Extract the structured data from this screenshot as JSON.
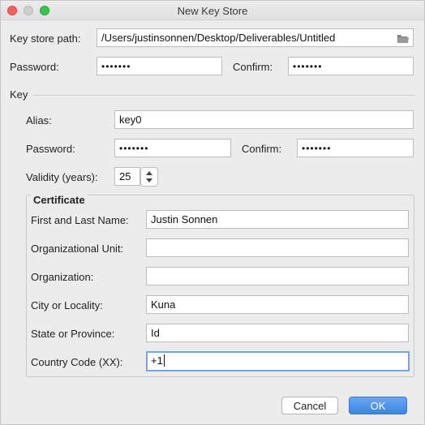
{
  "window": {
    "title": "New Key Store"
  },
  "keystore": {
    "path_label": "Key store path:",
    "path_value": "/Users/justinsonnen/Desktop/Deliverables/Untitled",
    "password_label": "Password:",
    "password_value": "•••••••",
    "confirm_label": "Confirm:",
    "confirm_value": "•••••••"
  },
  "key": {
    "section_label": "Key",
    "alias_label": "Alias:",
    "alias_value": "key0",
    "password_label": "Password:",
    "password_value": "•••••••",
    "confirm_label": "Confirm:",
    "confirm_value": "•••••••",
    "validity_label": "Validity (years):",
    "validity_value": "25"
  },
  "certificate": {
    "section_label": "Certificate",
    "fields": [
      {
        "label": "First and Last Name:",
        "value": "Justin Sonnen"
      },
      {
        "label": "Organizational Unit:",
        "value": ""
      },
      {
        "label": "Organization:",
        "value": ""
      },
      {
        "label": "City or Locality:",
        "value": "Kuna"
      },
      {
        "label": "State or Province:",
        "value": "Id"
      },
      {
        "label": "Country Code (XX):",
        "value": "+1"
      }
    ]
  },
  "buttons": {
    "cancel": "Cancel",
    "ok": "OK"
  },
  "colors": {
    "ok_button": "#3d84e6",
    "focus_ring": "#78a6dc",
    "close": "#fc605c",
    "maximize": "#34c84a"
  },
  "icons": {
    "browse": "folder-icon",
    "stepper": "stepper-arrows-icon"
  }
}
